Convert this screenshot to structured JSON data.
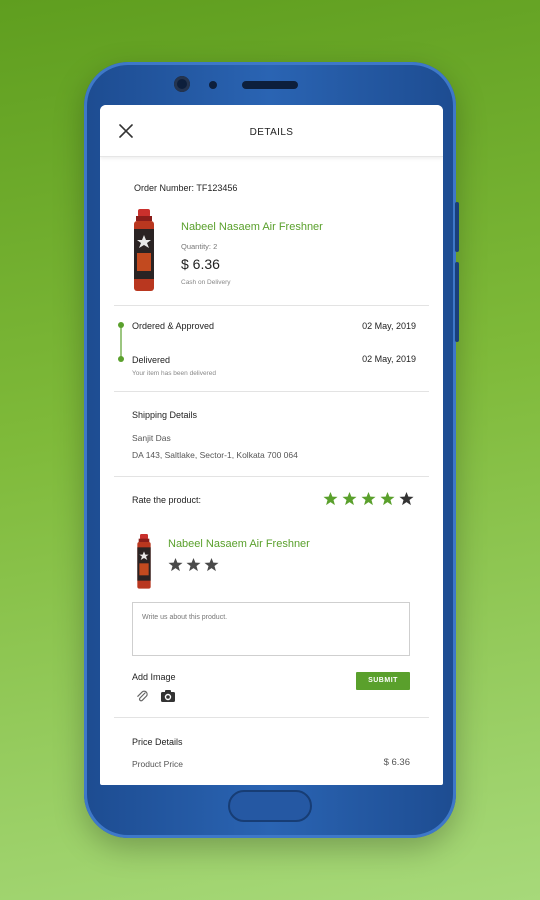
{
  "header": {
    "title": "DETAILS"
  },
  "order": {
    "number_label": "Order Number: TF123456",
    "product_name": "Nabeel Nasaem Air Freshner",
    "quantity": "Quantity: 2",
    "price": "$ 6.36",
    "payment": "Cash on Delivery"
  },
  "tracking": {
    "steps": [
      {
        "label": "Ordered & Approved",
        "date": "02 May, 2019"
      },
      {
        "label": "Delivered",
        "date": "02 May, 2019",
        "note": "Your item has been delivered"
      }
    ]
  },
  "shipping": {
    "title": "Shipping Details",
    "name": "Sanjit Das",
    "address": "DA 143, Saltlake, Sector-1, Kolkata 700 064"
  },
  "rating": {
    "label": "Rate the product:",
    "value": 4,
    "max": 5,
    "product_name": "Nabeel Nasaem Air Freshner",
    "product_stars": 3,
    "review_placeholder": "Write us about this product.",
    "add_image_label": "Add Image",
    "submit_label": "SUBMIT"
  },
  "price_details": {
    "title": "Price Details",
    "product_price_label": "Product Price",
    "product_price_value": "$ 6.36"
  },
  "colors": {
    "accent": "#5aa02c",
    "star": "#4a4a4a",
    "phone": "#2558a3"
  }
}
